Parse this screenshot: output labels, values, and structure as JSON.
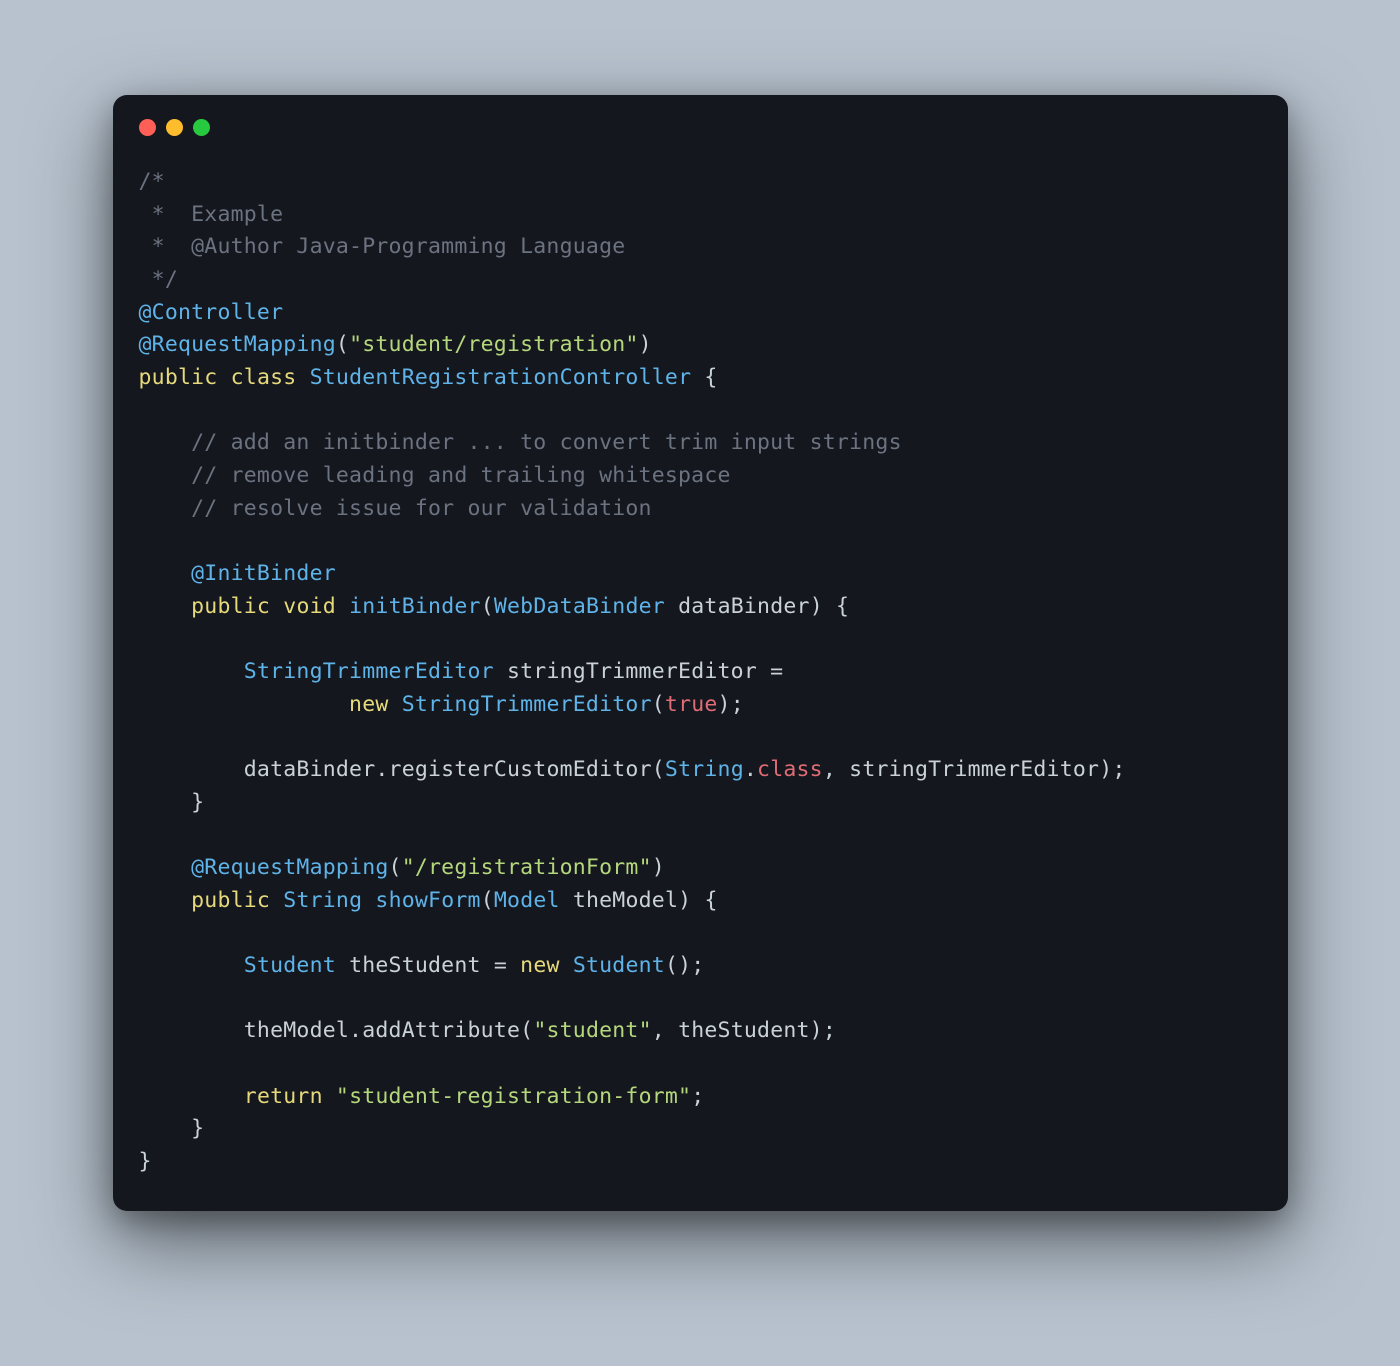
{
  "window": {
    "traffic_lights": [
      "red",
      "yellow",
      "green"
    ]
  },
  "code": {
    "tokens": [
      {
        "c": "comment",
        "t": "/*"
      },
      {
        "br": 1
      },
      {
        "c": "comment",
        "t": " *  Example"
      },
      {
        "br": 1
      },
      {
        "c": "comment",
        "t": " *  @Author Java-Programming Language"
      },
      {
        "br": 1
      },
      {
        "c": "comment",
        "t": " */"
      },
      {
        "br": 1
      },
      {
        "c": "annotation",
        "t": "@Controller"
      },
      {
        "br": 1
      },
      {
        "c": "annotation",
        "t": "@RequestMapping"
      },
      {
        "c": "paren",
        "t": "("
      },
      {
        "c": "string",
        "t": "\"student/registration\""
      },
      {
        "c": "paren",
        "t": ")"
      },
      {
        "br": 1
      },
      {
        "c": "keyword",
        "t": "public"
      },
      {
        "c": "ident",
        "t": " "
      },
      {
        "c": "keyword",
        "t": "class"
      },
      {
        "c": "ident",
        "t": " "
      },
      {
        "c": "classname",
        "t": "StudentRegistrationController"
      },
      {
        "c": "ident",
        "t": " "
      },
      {
        "c": "brace",
        "t": "{"
      },
      {
        "br": 1
      },
      {
        "br": 1
      },
      {
        "c": "ident",
        "t": "    "
      },
      {
        "c": "comment",
        "t": "// add an initbinder ... to convert trim input strings"
      },
      {
        "br": 1
      },
      {
        "c": "ident",
        "t": "    "
      },
      {
        "c": "comment",
        "t": "// remove leading and trailing whitespace"
      },
      {
        "br": 1
      },
      {
        "c": "ident",
        "t": "    "
      },
      {
        "c": "comment",
        "t": "// resolve issue for our validation"
      },
      {
        "br": 1
      },
      {
        "br": 1
      },
      {
        "c": "ident",
        "t": "    "
      },
      {
        "c": "annotation",
        "t": "@InitBinder"
      },
      {
        "br": 1
      },
      {
        "c": "ident",
        "t": "    "
      },
      {
        "c": "keyword",
        "t": "public"
      },
      {
        "c": "ident",
        "t": " "
      },
      {
        "c": "keyword",
        "t": "void"
      },
      {
        "c": "ident",
        "t": " "
      },
      {
        "c": "method",
        "t": "initBinder"
      },
      {
        "c": "paren",
        "t": "("
      },
      {
        "c": "type",
        "t": "WebDataBinder"
      },
      {
        "c": "ident",
        "t": " dataBinder"
      },
      {
        "c": "paren",
        "t": ")"
      },
      {
        "c": "ident",
        "t": " "
      },
      {
        "c": "brace",
        "t": "{"
      },
      {
        "br": 1
      },
      {
        "br": 1
      },
      {
        "c": "ident",
        "t": "        "
      },
      {
        "c": "type",
        "t": "StringTrimmerEditor"
      },
      {
        "c": "ident",
        "t": " stringTrimmerEditor "
      },
      {
        "c": "punct",
        "t": "="
      },
      {
        "br": 1
      },
      {
        "c": "ident",
        "t": "                "
      },
      {
        "c": "keyword",
        "t": "new"
      },
      {
        "c": "ident",
        "t": " "
      },
      {
        "c": "type",
        "t": "StringTrimmerEditor"
      },
      {
        "c": "paren",
        "t": "("
      },
      {
        "c": "literal",
        "t": "true"
      },
      {
        "c": "paren",
        "t": ")"
      },
      {
        "c": "punct",
        "t": ";"
      },
      {
        "br": 1
      },
      {
        "br": 1
      },
      {
        "c": "ident",
        "t": "        dataBinder"
      },
      {
        "c": "punct",
        "t": "."
      },
      {
        "c": "ident",
        "t": "registerCustomEditor"
      },
      {
        "c": "paren",
        "t": "("
      },
      {
        "c": "type",
        "t": "String"
      },
      {
        "c": "punct",
        "t": "."
      },
      {
        "c": "field",
        "t": "class"
      },
      {
        "c": "punct",
        "t": ","
      },
      {
        "c": "ident",
        "t": " stringTrimmerEditor"
      },
      {
        "c": "paren",
        "t": ")"
      },
      {
        "c": "punct",
        "t": ";"
      },
      {
        "br": 1
      },
      {
        "c": "ident",
        "t": "    "
      },
      {
        "c": "brace",
        "t": "}"
      },
      {
        "br": 1
      },
      {
        "br": 1
      },
      {
        "c": "ident",
        "t": "    "
      },
      {
        "c": "annotation",
        "t": "@RequestMapping"
      },
      {
        "c": "paren",
        "t": "("
      },
      {
        "c": "string",
        "t": "\"/registrationForm\""
      },
      {
        "c": "paren",
        "t": ")"
      },
      {
        "br": 1
      },
      {
        "c": "ident",
        "t": "    "
      },
      {
        "c": "keyword",
        "t": "public"
      },
      {
        "c": "ident",
        "t": " "
      },
      {
        "c": "type",
        "t": "String"
      },
      {
        "c": "ident",
        "t": " "
      },
      {
        "c": "method",
        "t": "showForm"
      },
      {
        "c": "paren",
        "t": "("
      },
      {
        "c": "type",
        "t": "Model"
      },
      {
        "c": "ident",
        "t": " theModel"
      },
      {
        "c": "paren",
        "t": ")"
      },
      {
        "c": "ident",
        "t": " "
      },
      {
        "c": "brace",
        "t": "{"
      },
      {
        "br": 1
      },
      {
        "br": 1
      },
      {
        "c": "ident",
        "t": "        "
      },
      {
        "c": "type",
        "t": "Student"
      },
      {
        "c": "ident",
        "t": " theStudent "
      },
      {
        "c": "punct",
        "t": "="
      },
      {
        "c": "ident",
        "t": " "
      },
      {
        "c": "keyword",
        "t": "new"
      },
      {
        "c": "ident",
        "t": " "
      },
      {
        "c": "type",
        "t": "Student"
      },
      {
        "c": "paren",
        "t": "()"
      },
      {
        "c": "punct",
        "t": ";"
      },
      {
        "br": 1
      },
      {
        "br": 1
      },
      {
        "c": "ident",
        "t": "        theModel"
      },
      {
        "c": "punct",
        "t": "."
      },
      {
        "c": "ident",
        "t": "addAttribute"
      },
      {
        "c": "paren",
        "t": "("
      },
      {
        "c": "string",
        "t": "\"student\""
      },
      {
        "c": "punct",
        "t": ","
      },
      {
        "c": "ident",
        "t": " theStudent"
      },
      {
        "c": "paren",
        "t": ")"
      },
      {
        "c": "punct",
        "t": ";"
      },
      {
        "br": 1
      },
      {
        "br": 1
      },
      {
        "c": "ident",
        "t": "        "
      },
      {
        "c": "keyword",
        "t": "return"
      },
      {
        "c": "ident",
        "t": " "
      },
      {
        "c": "string",
        "t": "\"student-registration-form\""
      },
      {
        "c": "punct",
        "t": ";"
      },
      {
        "br": 1
      },
      {
        "c": "ident",
        "t": "    "
      },
      {
        "c": "brace",
        "t": "}"
      },
      {
        "br": 1
      },
      {
        "c": "brace",
        "t": "}"
      }
    ]
  }
}
